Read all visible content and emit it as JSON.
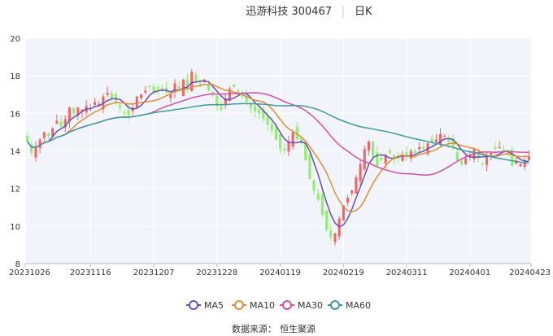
{
  "title": "迅游科技 300467",
  "period": "日K",
  "source_label": "数据来源：",
  "source_value": "恒生聚源",
  "colors": {
    "up": "#ee6666",
    "down": "#91ee6e",
    "plot_bg": "#f2f4fb",
    "grid": "#ffffff",
    "axis_text": "#333333",
    "title_divider": "#cccccc"
  },
  "chart_data": {
    "type": "candlestick",
    "yticks": [
      8,
      10,
      12,
      14,
      16,
      18,
      20
    ],
    "ylim": [
      8,
      20
    ],
    "x_tick_labels": [
      "20231026",
      "20231116",
      "20231207",
      "20231228",
      "20240119",
      "20240219",
      "20240311",
      "20240401",
      "20240423"
    ],
    "x_tick_index": [
      0,
      15,
      30,
      45,
      60,
      75,
      90,
      105,
      119
    ],
    "n": 120,
    "legend": [
      {
        "name": "MA5",
        "color": "#6a4fb3"
      },
      {
        "name": "MA10",
        "color": "#e58a3a"
      },
      {
        "name": "MA30",
        "color": "#d44ea9"
      },
      {
        "name": "MA60",
        "color": "#3f9b9b"
      }
    ],
    "close": [
      14.5,
      13.9,
      14.2,
      14.6,
      15.0,
      14.8,
      15.2,
      15.6,
      15.3,
      15.7,
      16.3,
      16.0,
      16.3,
      16.2,
      16.4,
      16.3,
      16.6,
      16.5,
      16.9,
      17.1,
      16.8,
      16.6,
      16.3,
      16.0,
      15.9,
      16.3,
      16.9,
      17.0,
      17.2,
      17.4,
      17.1,
      17.3,
      17.2,
      17.1,
      17.0,
      17.6,
      17.2,
      17.8,
      17.4,
      18.2,
      17.7,
      17.5,
      17.8,
      17.2,
      17.0,
      16.4,
      16.2,
      16.8,
      17.3,
      17.4,
      17.0,
      16.9,
      16.6,
      16.3,
      16.1,
      16.0,
      15.7,
      15.4,
      15.1,
      14.6,
      14.1,
      14.0,
      14.5,
      15.0,
      14.6,
      14.4,
      13.5,
      12.5,
      11.9,
      11.4,
      10.6,
      9.8,
      9.4,
      9.6,
      10.4,
      11.1,
      11.5,
      11.9,
      12.6,
      13.3,
      14.1,
      14.5,
      13.7,
      13.2,
      13.5,
      13.8,
      13.9,
      13.6,
      13.6,
      13.8,
      13.7,
      14.0,
      13.9,
      14.2,
      14.1,
      14.4,
      14.5,
      14.6,
      14.9,
      14.8,
      14.5,
      14.2,
      13.5,
      13.3,
      13.6,
      13.8,
      14.1,
      13.6,
      13.3,
      13.7,
      13.9,
      14.1,
      14.2,
      13.9,
      13.8,
      13.2,
      13.5,
      13.3,
      13.5,
      13.7
    ]
  }
}
